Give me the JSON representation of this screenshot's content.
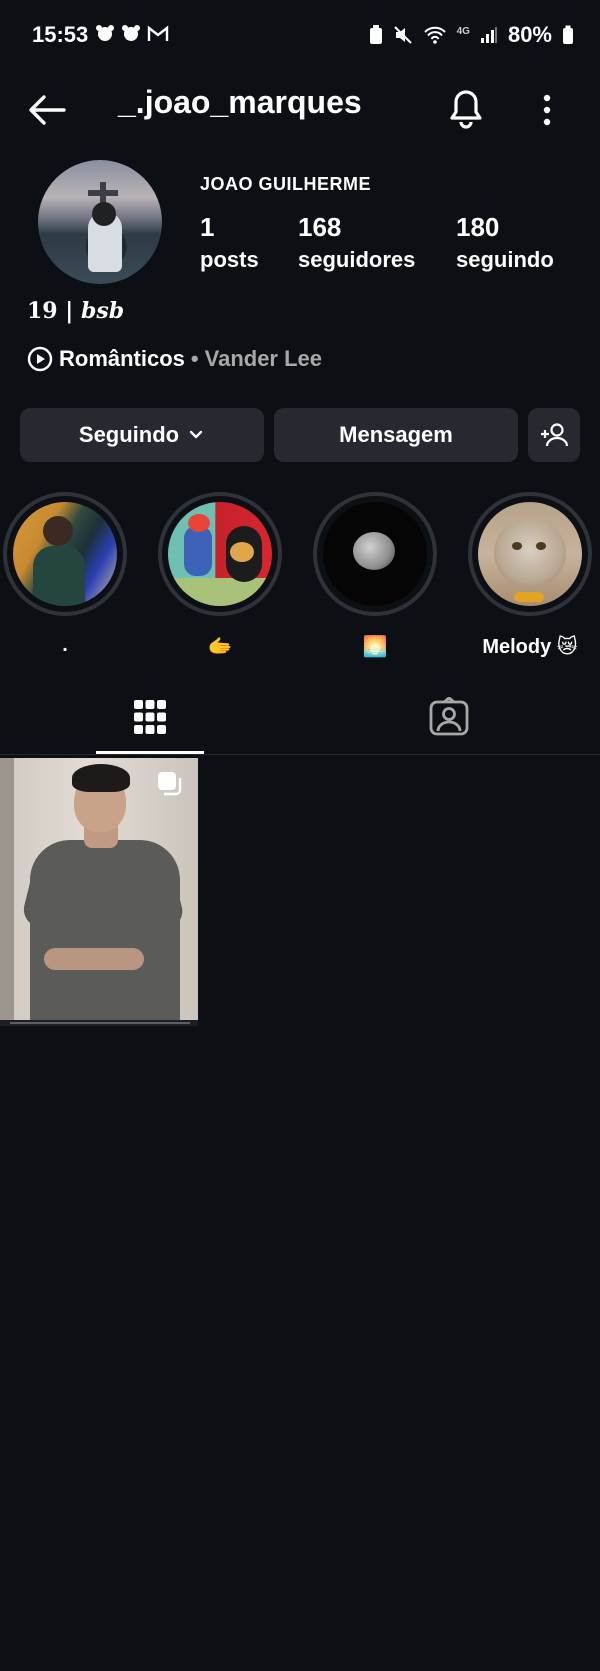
{
  "status_bar": {
    "time": "15:53",
    "battery": "80%",
    "network": "4G"
  },
  "header": {
    "username": "_.joao_marques"
  },
  "profile": {
    "full_name": "JOAO GUILHERME",
    "stats": [
      {
        "value": "1",
        "label": "posts"
      },
      {
        "value": "168",
        "label": "seguidores"
      },
      {
        "value": "180",
        "label": "seguindo"
      }
    ],
    "bio_prefix": "19 | ",
    "bio_italic": "bsb",
    "music": {
      "song": "Românticos",
      "separator": "•",
      "artist": "Vander Lee"
    }
  },
  "actions": {
    "following_label": "Seguindo",
    "message_label": "Mensagem"
  },
  "highlights": [
    {
      "label": "."
    },
    {
      "label": "🫱"
    },
    {
      "label": "🌅"
    },
    {
      "label": "Melody 😿"
    }
  ],
  "colors": {
    "background": "#0c1014",
    "button": "#262a30",
    "secondary_text": "#a8a8a8"
  }
}
